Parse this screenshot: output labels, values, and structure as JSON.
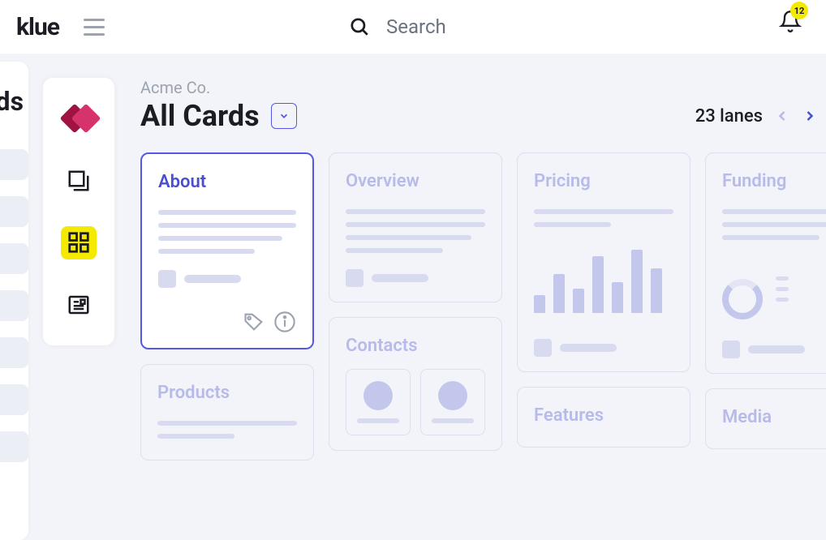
{
  "header": {
    "logo": "klue",
    "search_placeholder": "Search",
    "notification_count": "12"
  },
  "rail0": {
    "truncated_label": "ds"
  },
  "breadcrumb": "Acme Co.",
  "title": "All Cards",
  "lanes_count_label": "23 lanes",
  "cards": {
    "about": "About",
    "overview": "Overview",
    "pricing": "Pricing",
    "funding": "Funding",
    "products": "Products",
    "contacts": "Contacts",
    "features": "Features",
    "media": "Media"
  }
}
